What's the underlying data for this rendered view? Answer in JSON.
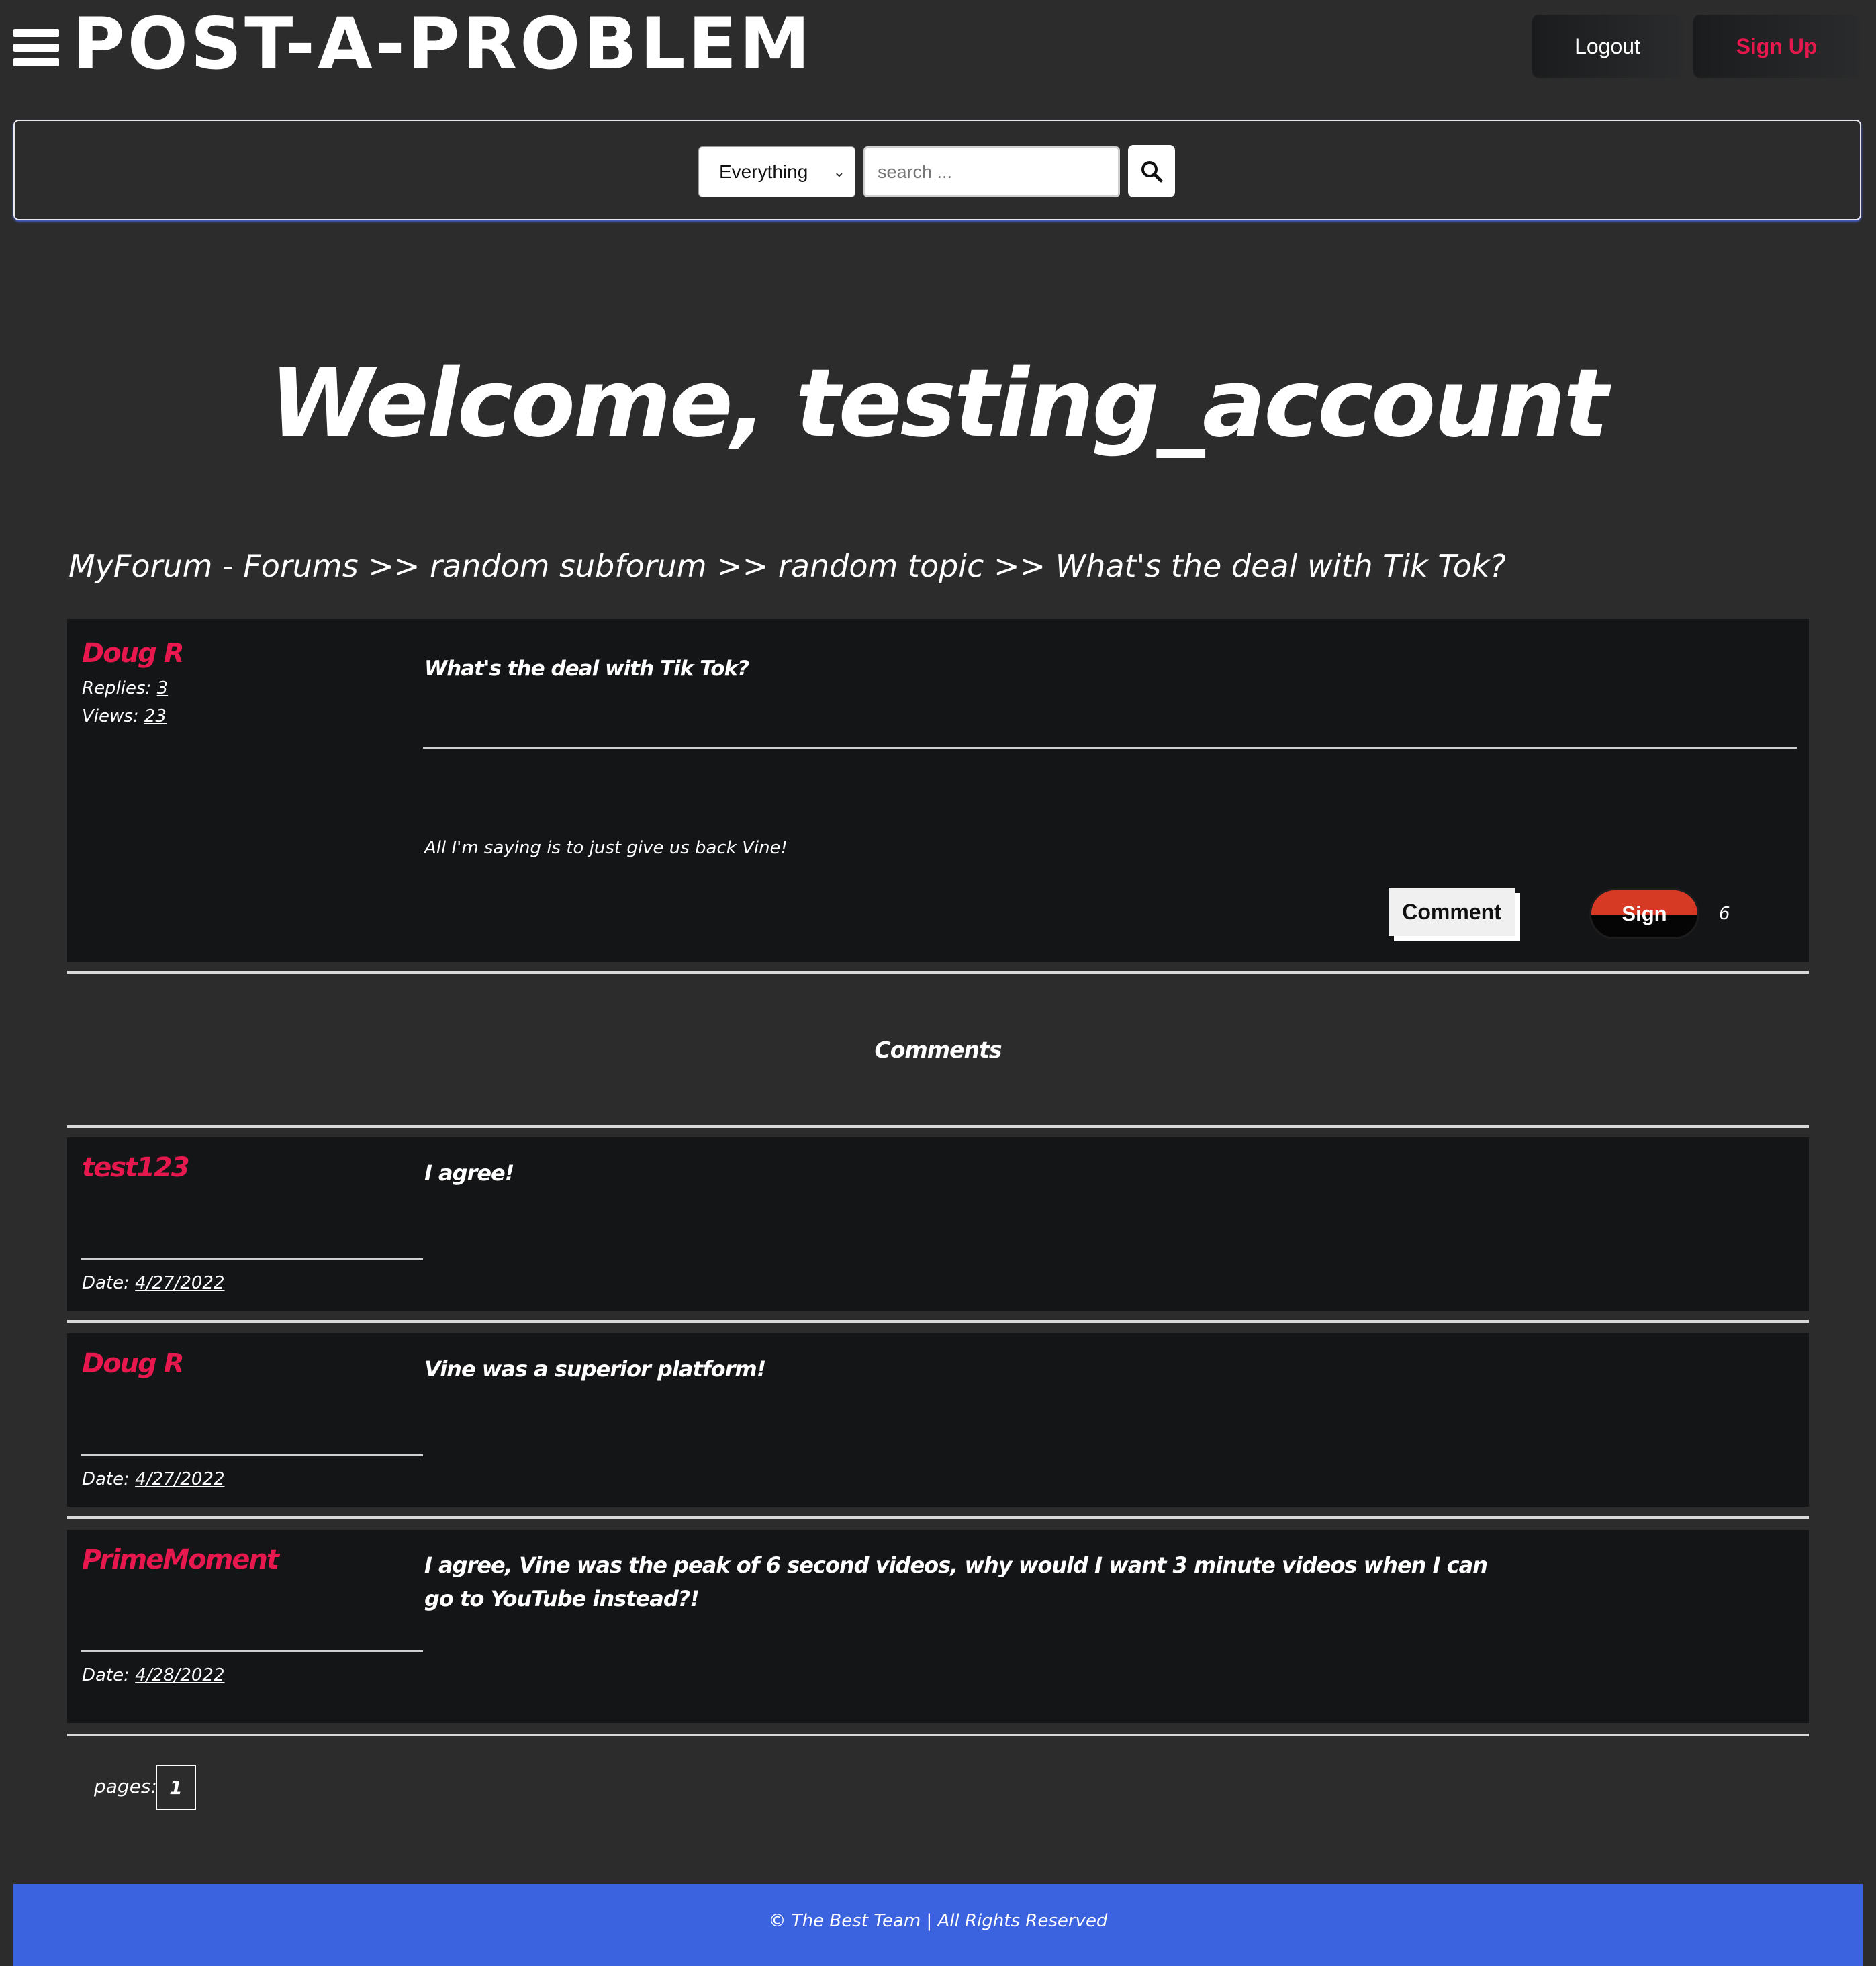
{
  "header": {
    "logo": "POST-A-PROBLEM",
    "logout_label": "Logout",
    "signup_label": "Sign Up"
  },
  "search": {
    "scope_selected": "Everything",
    "placeholder": "search ...",
    "search_icon": "search-icon"
  },
  "welcome": "Welcome, testing_account",
  "breadcrumb": "MyForum - Forums >> random subforum >> random topic >> What's the deal with Tik Tok?",
  "post": {
    "author": "Doug R",
    "replies_label": "Replies:",
    "replies": "3",
    "views_label": "Views:",
    "views": "23",
    "title": "What's the deal with Tik Tok?",
    "body": "All I'm saying is to just give us back Vine!",
    "comment_label": "Comment",
    "sign_label": "Sign",
    "sign_count": "6"
  },
  "comments_title": "Comments",
  "comments": [
    {
      "author": "test123",
      "text": "I agree!",
      "date_label": "Date:",
      "date": "4/27/2022"
    },
    {
      "author": "Doug R",
      "text": "Vine was a superior platform!",
      "date_label": "Date:",
      "date": "4/27/2022"
    },
    {
      "author": "PrimeMoment",
      "text_line1": "I agree, Vine was the peak of 6 second videos, why would I want 3 minute videos when I can",
      "text_line2": "go to YouTube instead?!",
      "date_label": "Date:",
      "date": "4/28/2022"
    }
  ],
  "pagination": {
    "label": "pages:",
    "current": "1"
  },
  "footer": "© The Best Team | All Rights Reserved",
  "colors": {
    "accent": "#e6184d",
    "footer_bg": "#3c63df",
    "page_bg": "#2c2c2d",
    "panel_bg": "#141517"
  }
}
